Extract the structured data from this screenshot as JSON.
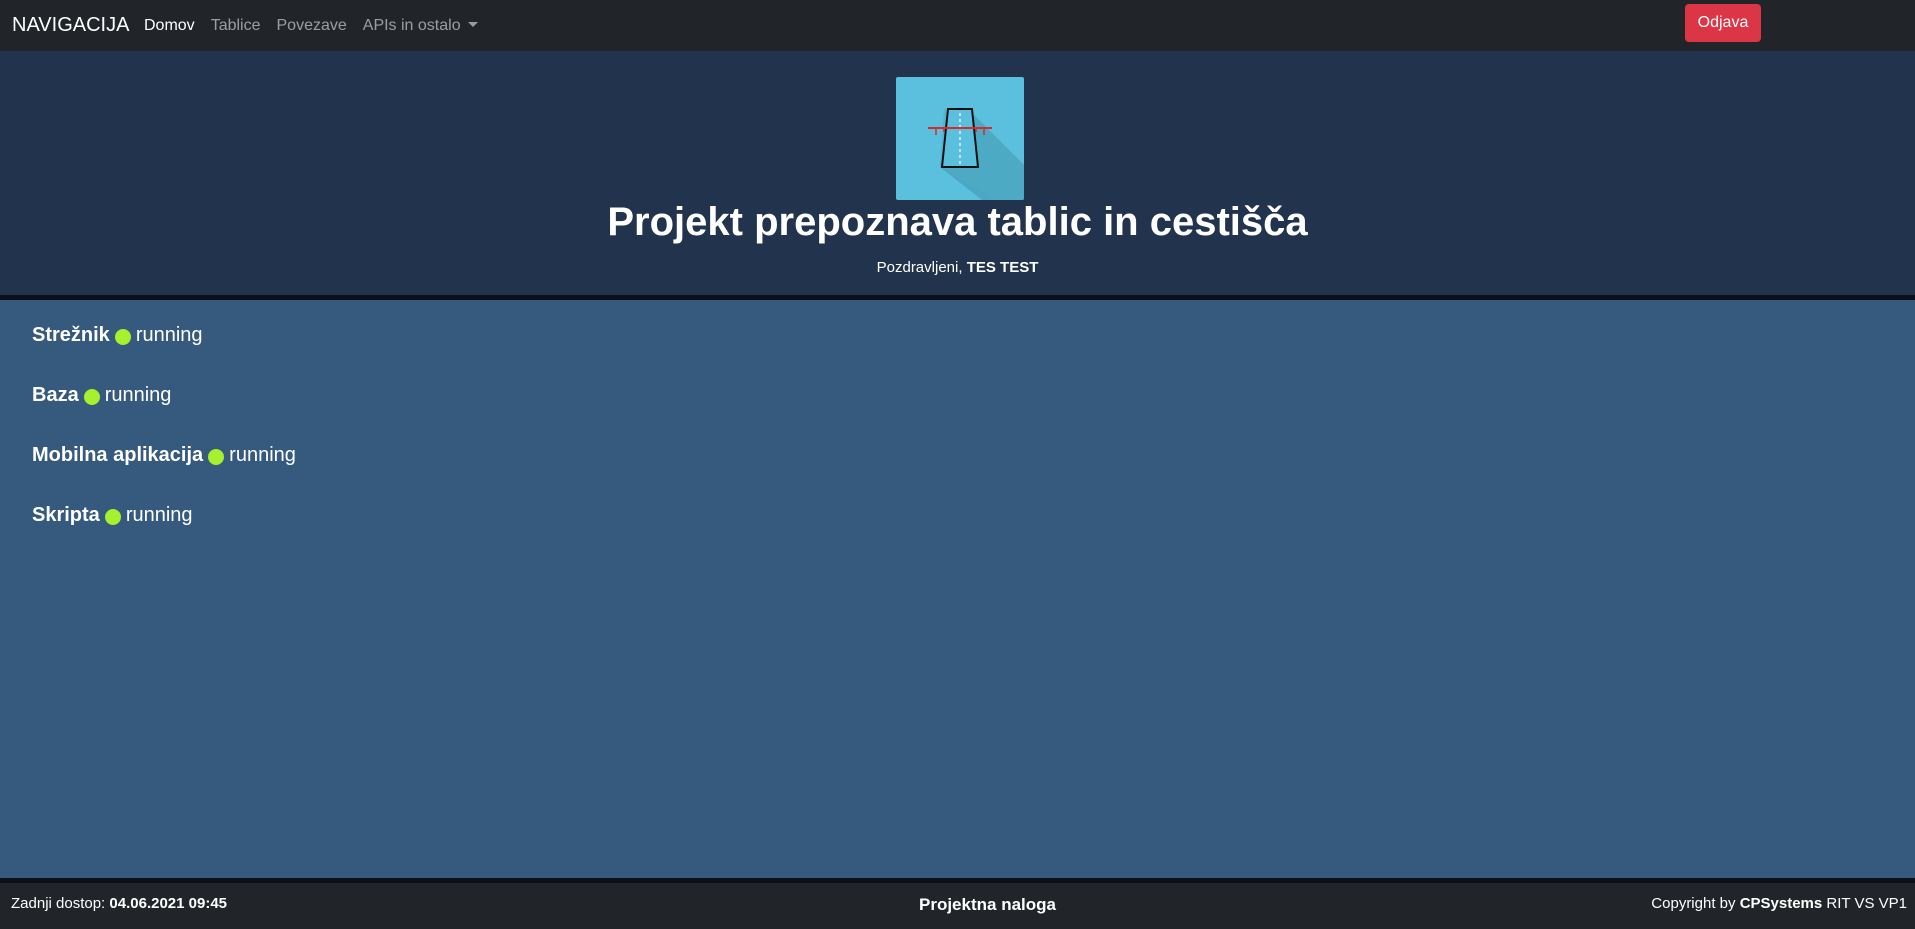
{
  "navbar": {
    "brand": "NAVIGACIJA",
    "links": [
      {
        "label": "Domov",
        "active": true
      },
      {
        "label": "Tablice",
        "active": false
      },
      {
        "label": "Povezave",
        "active": false
      },
      {
        "label": "APIs in ostalo",
        "active": false,
        "dropdown": true
      }
    ],
    "logout_label": "Odjava",
    "logout_color": "#dc3545"
  },
  "hero": {
    "logo_icon": "highway-road-icon",
    "title": "Projekt prepoznava tablic in cestišča",
    "greeting_prefix": "Pozdravljeni,",
    "user_name": "TES TEST"
  },
  "services": [
    {
      "name": "Strežnik",
      "status": "running",
      "status_color": "#a6f02d"
    },
    {
      "name": "Baza",
      "status": "running",
      "status_color": "#a6f02d"
    },
    {
      "name": "Mobilna aplikacija",
      "status": "running",
      "status_color": "#a6f02d"
    },
    {
      "name": "Skripta",
      "status": "running",
      "status_color": "#a6f02d"
    }
  ],
  "footer": {
    "last_access_label": "Zadnji dostop:",
    "last_access_value": "04.06.2021 09:45",
    "center_text": "Projektna naloga",
    "copyright_prefix": "Copyright by",
    "copyright_company": "CPSystems",
    "copyright_suffix": "RIT VS VP1"
  }
}
